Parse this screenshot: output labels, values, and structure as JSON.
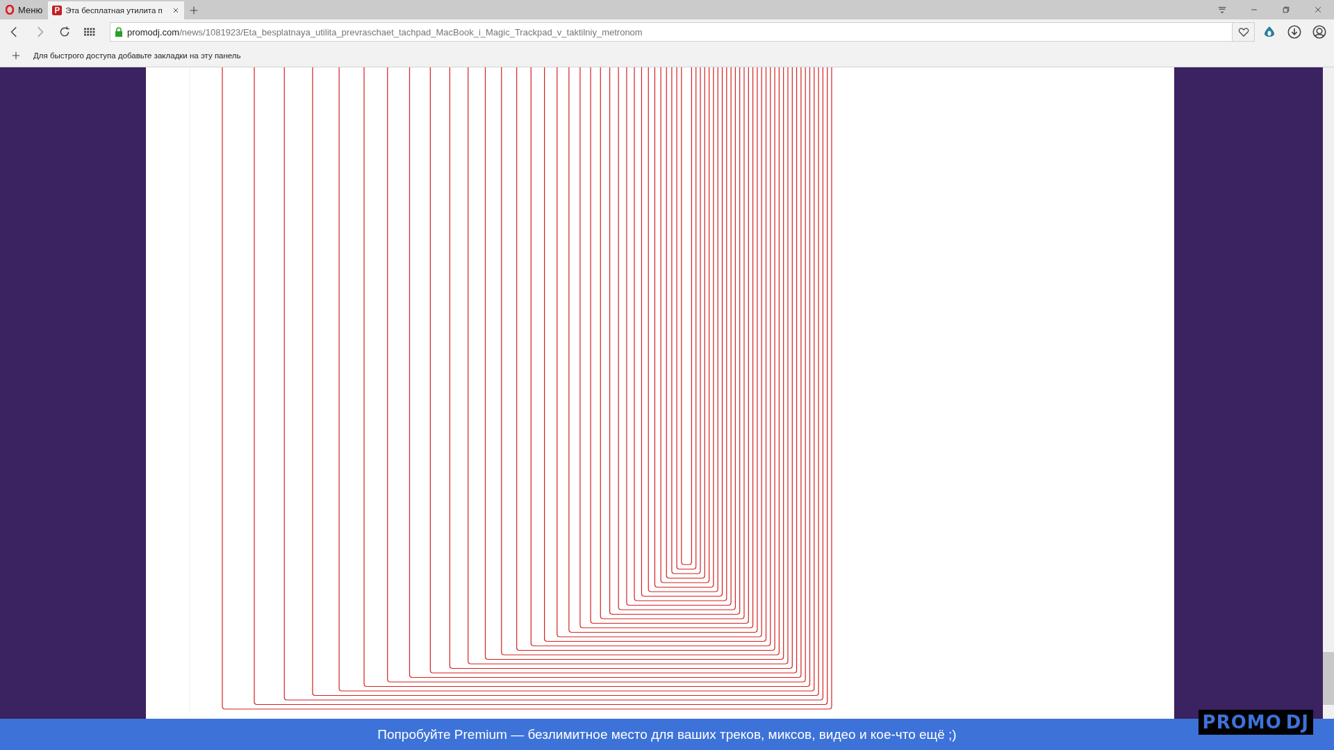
{
  "browser": {
    "menu_label": "Меню",
    "tabs": [
      {
        "title": "Эта бесплатная утилита п",
        "selected": true
      }
    ],
    "url": {
      "domain": "promodj.com",
      "path": "/news/1081923/Eta_besplatnaya_utilita_prevraschaet_tachpad_MacBook_i_Magic_Trackpad_v_taktilniy_metronom"
    },
    "bookmarks_hint": "Для быстрого доступа добавьте закладки на эту панель"
  },
  "banner": {
    "text": "Попробуйте Premium — безлимитное место для ваших треков, миксов, видео и кое-что ещё ;)"
  },
  "logo": {
    "left": "PROMO",
    "right": "DJ"
  }
}
